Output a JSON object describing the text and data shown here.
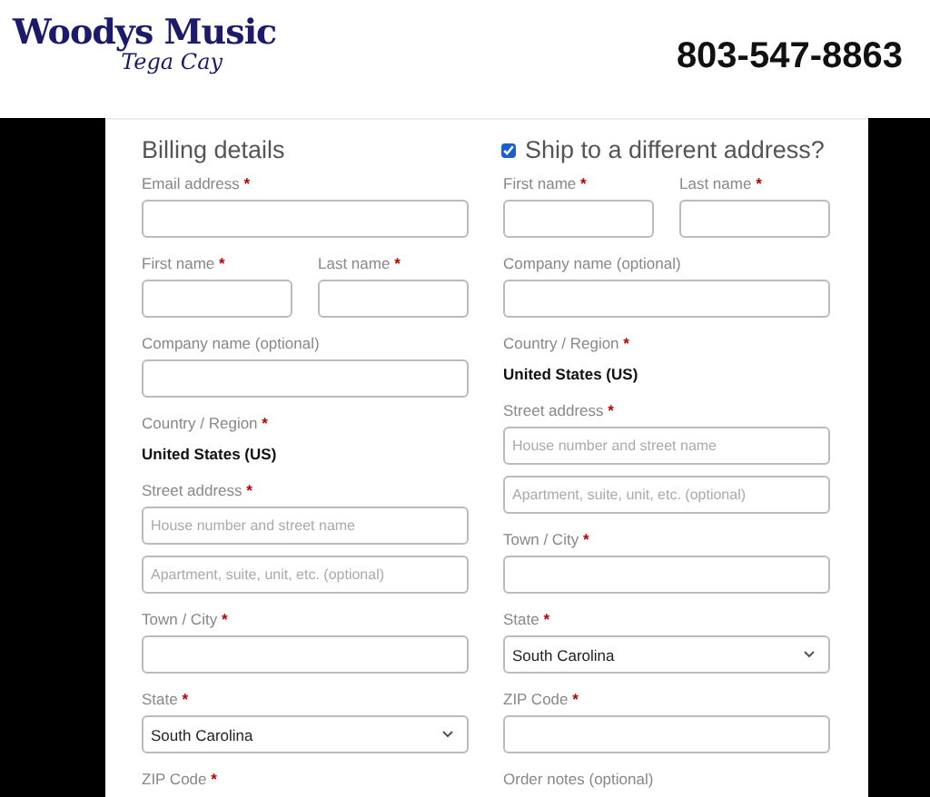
{
  "header": {
    "logo_title": "Woodys Music",
    "logo_subtitle": "Tega Cay",
    "phone": "803-547-8863"
  },
  "billing": {
    "title": "Billing details",
    "fields": [
      {
        "kind": "input",
        "label": "Email address",
        "mark": "*"
      },
      {
        "kind": "pair",
        "items": [
          {
            "label": "First name",
            "mark": "*"
          },
          {
            "label": "Last name",
            "mark": "*"
          }
        ]
      },
      {
        "kind": "input",
        "label": "Company name (optional)"
      },
      {
        "kind": "static",
        "label": "Country / Region",
        "mark": "*",
        "value": "United States (US)"
      },
      {
        "kind": "input",
        "label": "Street address",
        "mark": "*",
        "placeholder": "House number and street name"
      },
      {
        "kind": "extra",
        "placeholder": "Apartment, suite, unit, etc. (optional)"
      },
      {
        "kind": "input",
        "label": "Town / City",
        "mark": "*"
      },
      {
        "kind": "select",
        "label": "State",
        "mark": "*",
        "value": "South Carolina"
      },
      {
        "kind": "cut",
        "label": "ZIP Code",
        "mark": "*"
      }
    ]
  },
  "shipping": {
    "title": "Ship to a different address?",
    "checked": true,
    "fields": [
      {
        "kind": "pair",
        "items": [
          {
            "label": "First name",
            "mark": "*"
          },
          {
            "label": "Last name",
            "mark": "*"
          }
        ]
      },
      {
        "kind": "input",
        "label": "Company name (optional)"
      },
      {
        "kind": "static",
        "label": "Country / Region",
        "mark": "*",
        "value": "United States (US)"
      },
      {
        "kind": "input",
        "label": "Street address",
        "mark": "*",
        "placeholder": "House number and street name"
      },
      {
        "kind": "extra",
        "placeholder": "Apartment, suite, unit, etc. (optional)"
      },
      {
        "kind": "input",
        "label": "Town / City",
        "mark": "*"
      },
      {
        "kind": "select",
        "label": "State",
        "mark": "*",
        "value": "South Carolina"
      },
      {
        "kind": "input",
        "label": "ZIP Code",
        "mark": "*"
      },
      {
        "kind": "cut",
        "label": "Order notes (optional)"
      }
    ]
  }
}
